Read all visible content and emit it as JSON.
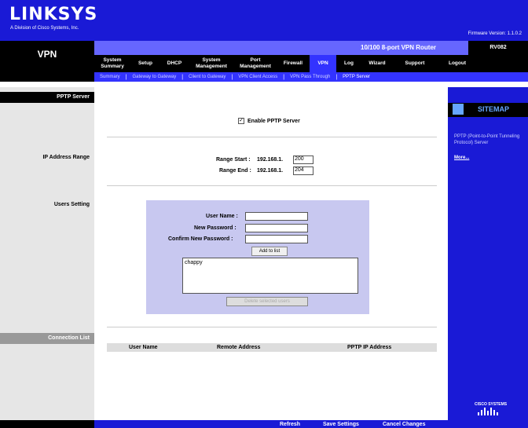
{
  "brand": {
    "logo": "LINKSYS",
    "logo_sub": "A Division of Cisco Systems, Inc.",
    "firmware": "Firmware Version: 1.1.0.2"
  },
  "header": {
    "section": "VPN",
    "router_name": "10/100 8-port VPN Router",
    "router_model": "RV082"
  },
  "tabs": [
    {
      "label": "System Summary"
    },
    {
      "label": "Setup"
    },
    {
      "label": "DHCP"
    },
    {
      "label": "System Management"
    },
    {
      "label": "Port Management"
    },
    {
      "label": "Firewall"
    },
    {
      "label": "VPN"
    },
    {
      "label": "Log"
    },
    {
      "label": "Wizard"
    },
    {
      "label": "Support"
    },
    {
      "label": "Logout"
    }
  ],
  "subnav": [
    {
      "label": "Summary"
    },
    {
      "label": "Gateway to Gateway"
    },
    {
      "label": "Client to Gateway"
    },
    {
      "label": "VPN Client Access"
    },
    {
      "label": "VPN Pass Through"
    },
    {
      "label": "PPTP Server"
    }
  ],
  "left": {
    "pptp_server": "PPTP Server",
    "ip_range": "IP Address Range",
    "users_setting": "Users Setting",
    "connection_list": "Connection List"
  },
  "pptp": {
    "enable_label": "Enable PPTP Server",
    "enabled": true,
    "range_start_label": "Range Start :",
    "range_end_label": "Range End :",
    "ip_prefix": "192.168.1.",
    "range_start": "200",
    "range_end": "204"
  },
  "users": {
    "user_name_label": "User Name :",
    "new_password_label": "New Password :",
    "confirm_password_label": "Confirm New Password :",
    "add_button": "Add to list",
    "list": [
      "chappy"
    ],
    "delete_button": "Delete selected users"
  },
  "connections": {
    "columns": [
      "User Name",
      "Remote Address",
      "PPTP IP Address"
    ]
  },
  "sitemap": {
    "title": "SITEMAP",
    "description": "PPTP (Point-to-Point Tunneling Protocol) Server",
    "more": "More..."
  },
  "footer": {
    "refresh": "Refresh",
    "save": "Save Settings",
    "cancel": "Cancel Changes",
    "cisco": "CISCO SYSTEMS"
  }
}
